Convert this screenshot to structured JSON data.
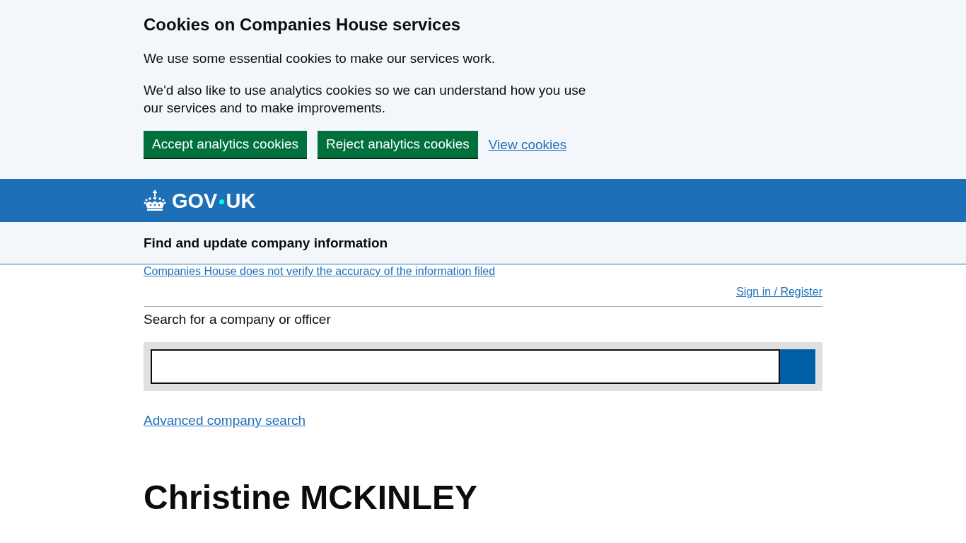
{
  "cookie_banner": {
    "heading": "Cookies on Companies House services",
    "paragraphs": [
      "We use some essential cookies to make our services work.",
      "We'd also like to use analytics cookies so we can understand how you use our services and to make improvements."
    ],
    "buttons": [
      "Accept analytics cookies",
      "Reject analytics cookies"
    ],
    "link": "View cookies"
  },
  "header": {
    "logo": {
      "parts": [
        "GOV",
        "UK"
      ]
    }
  },
  "service_header": {
    "title": "Find and update company information"
  },
  "notice_link": "Companies House does not verify the accuracy of the information filed",
  "sign_in_link": "Sign in / Register",
  "search": {
    "label": "Search for a company or officer"
  },
  "advanced_search_link": "Advanced company search",
  "page_heading": "Christine MCKINLEY"
}
